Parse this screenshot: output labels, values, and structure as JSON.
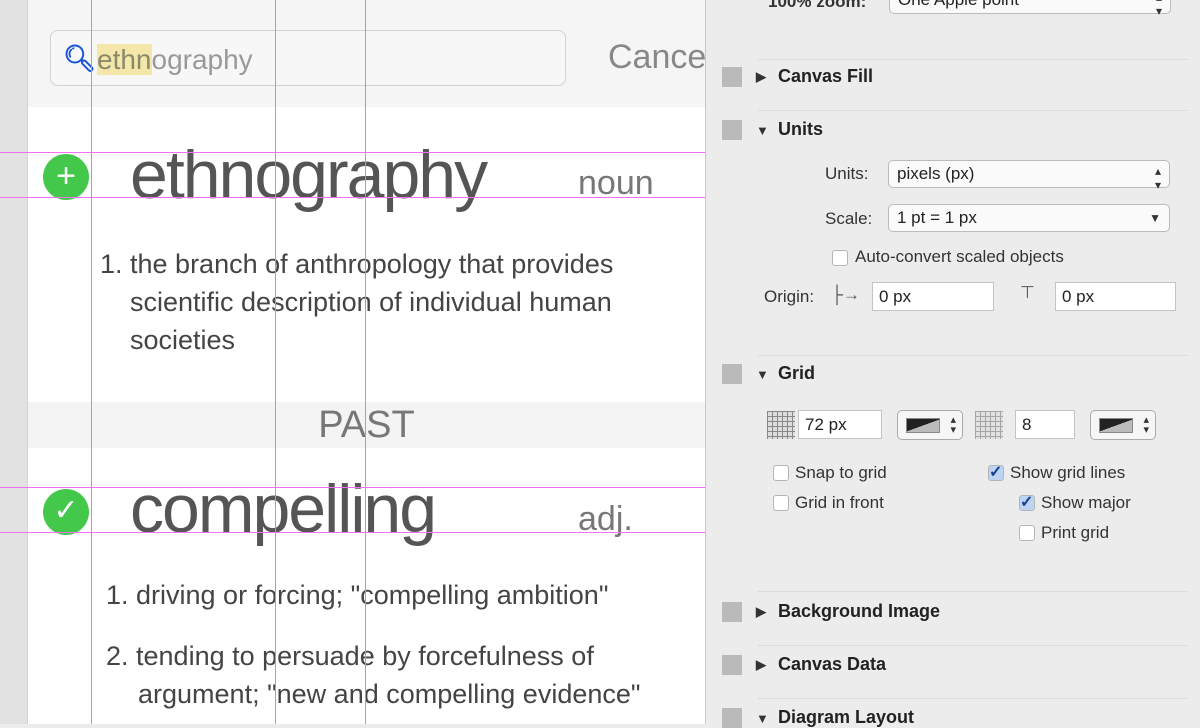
{
  "canvas": {
    "search": {
      "value": "ethnography",
      "highlight": "ethn",
      "rest": "ography",
      "icon": "search-icon"
    },
    "cancel_label": "Cance",
    "entries": [
      {
        "word": "ethnography",
        "pos": "noun",
        "status_icon": "plus-circle-icon",
        "definitions": [
          "1. the branch of anthropology that provides",
          "scientific description of individual human",
          "societies"
        ]
      },
      {
        "word": "compelling",
        "pos": "adj.",
        "status_icon": "check-circle-icon",
        "definitions": [
          "1. driving or forcing; \"compelling ambition\"",
          "2. tending to persuade by forcefulness of",
          "argument; \"new and compelling evidence\""
        ]
      }
    ],
    "section_past": "PAST",
    "accent_green": "#43c84b",
    "guide_color": "#f070f0"
  },
  "inspector": {
    "zoom_label": "100% zoom:",
    "zoom_value": "One Apple point",
    "canvas_fill": "Canvas Fill",
    "units": {
      "title": "Units",
      "units_label": "Units:",
      "units_value": "pixels (px)",
      "scale_label": "Scale:",
      "scale_value": "1 pt = 1 px",
      "auto_convert": "Auto-convert scaled objects",
      "auto_convert_checked": false,
      "origin_label": "Origin:",
      "origin_x": "0 px",
      "origin_y": "0 px"
    },
    "grid": {
      "title": "Grid",
      "major_spacing": "72 px",
      "minor_divisions": "8",
      "snap_to_grid": "Snap to grid",
      "snap_checked": false,
      "grid_in_front": "Grid in front",
      "front_checked": false,
      "show_grid_lines": "Show grid lines",
      "show_lines_checked": true,
      "show_major": "Show major",
      "show_major_checked": true,
      "print_grid": "Print grid",
      "print_checked": false
    },
    "background_image": "Background Image",
    "canvas_data": "Canvas Data",
    "diagram_layout": "Diagram Layout"
  }
}
